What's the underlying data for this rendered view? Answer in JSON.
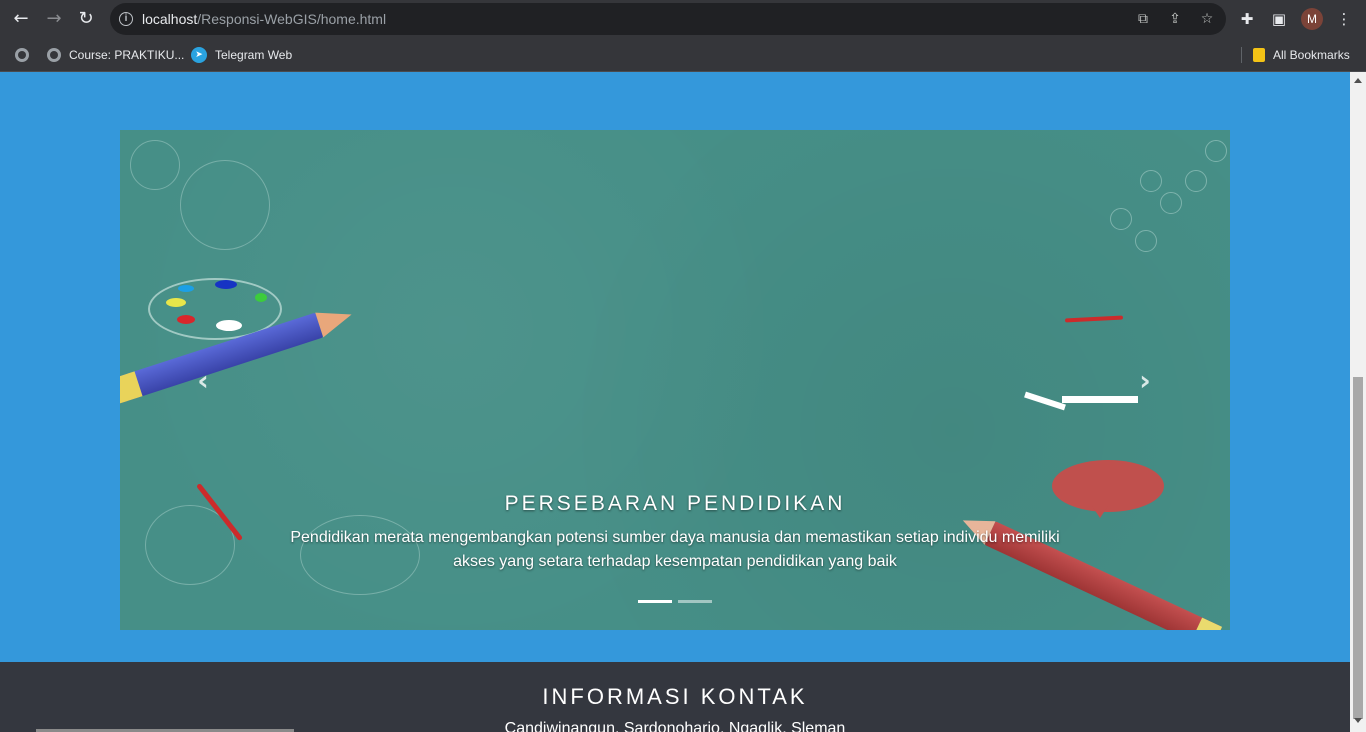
{
  "browser": {
    "url_host": "localhost",
    "url_path": "/Responsi-WebGIS/home.html",
    "avatar_letter": "M",
    "bookmarks": [
      {
        "label": "Course: PRAKTIKU..."
      },
      {
        "label": "Telegram Web"
      }
    ],
    "all_bookmarks_label": "All Bookmarks"
  },
  "carousel": {
    "caption_title": "PERSEBARAN PENDIDIKAN",
    "caption_text": "Pendidikan merata mengembangkan potensi sumber daya manusia dan memastikan setiap individu memiliki akses yang setara terhadap kesempatan pendidikan yang baik",
    "prev_icon": "‹",
    "next_icon": "›",
    "active_slide": 1,
    "slide_count": 2
  },
  "footer": {
    "title": "INFORMASI KONTAK",
    "address": "Candiwinangun, Sardonoharjo, Ngaglik, Sleman"
  },
  "colors": {
    "page_bg": "#3498db",
    "carousel_bg": "#468f87",
    "footer_bg": "#34373f"
  }
}
